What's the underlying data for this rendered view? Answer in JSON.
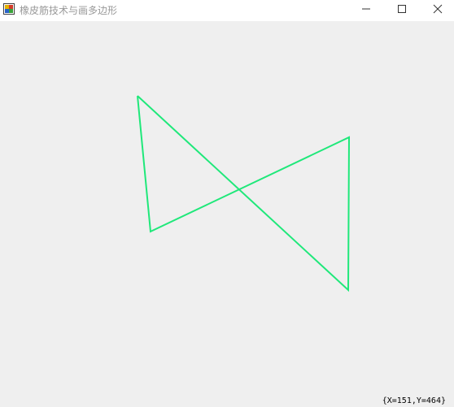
{
  "window": {
    "title": "橡皮筋技术与画多边形"
  },
  "status": {
    "coordinates_text": "{X=151,Y=464}"
  },
  "polygon": {
    "stroke_color": "#1fe87a"
  },
  "colors": {
    "client_background": "#efefef",
    "titlebar_background": "#ffffff",
    "title_text": "#999999"
  },
  "icons": {
    "app": "app-icon",
    "minimize": "minimize-icon",
    "maximize": "maximize-icon",
    "close": "close-icon"
  }
}
